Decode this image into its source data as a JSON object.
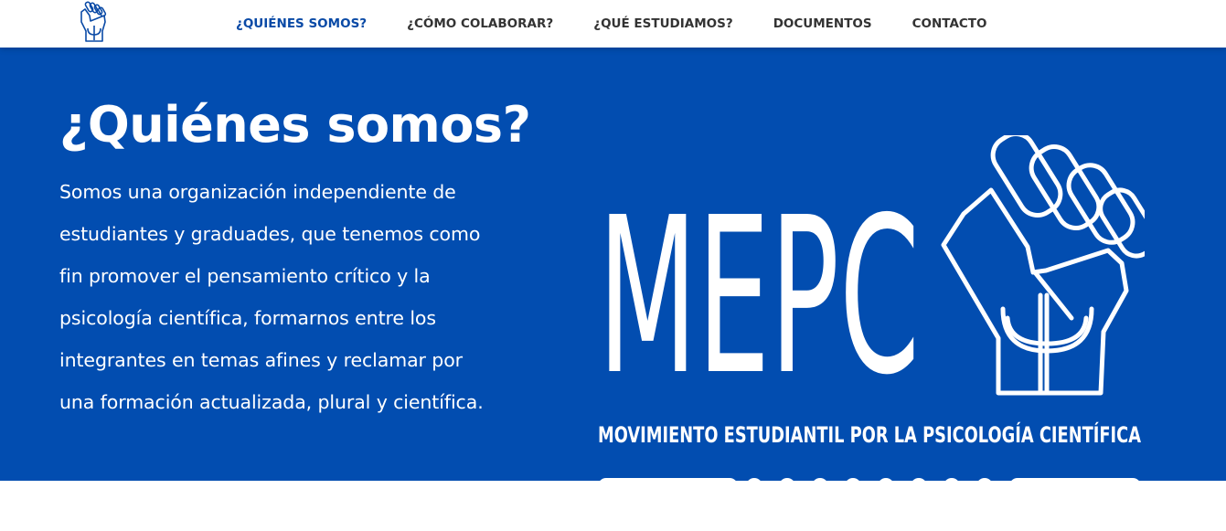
{
  "navbar": {
    "logo_icon": "fist-psi-logo-icon",
    "items": [
      {
        "label": "¿QUIÉNES SOMOS?",
        "active": true
      },
      {
        "label": "¿CÓMO COLABORAR?",
        "active": false
      },
      {
        "label": "¿QUÉ ESTUDIAMOS?",
        "active": false
      },
      {
        "label": "DOCUMENTOS",
        "active": false
      },
      {
        "label": "CONTACTO",
        "active": false
      }
    ]
  },
  "hero": {
    "title": "¿Quiénes somos?",
    "text_lines": [
      "Somos una organización independiente de",
      "estudiantes y graduades, que tenemos como",
      "fin promover el pensamiento crítico y la",
      "psicología científica, formarnos entre los",
      "integrantes en temas afines y reclamar por",
      "una formación actualizada, plural y científica."
    ],
    "brand": {
      "acronym": "MEPC",
      "tagline": "MOVIMIENTO ESTUDIANTIL POR LA PSICOLOGÍA CIENTÍFICA",
      "icon": "raised-fist-psi-icon"
    }
  },
  "colors": {
    "primary": "#024db0",
    "nav_active": "#0a4aa6",
    "nav_text": "#333333",
    "white": "#ffffff"
  }
}
